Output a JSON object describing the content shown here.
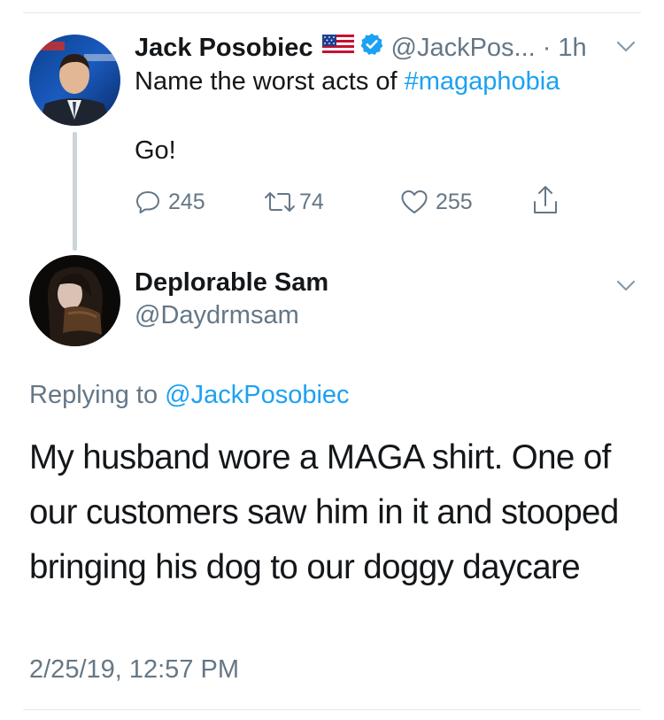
{
  "tweet1": {
    "name": "Jack Posobiec",
    "handle": "@JackPos...",
    "time": "· 1h",
    "text_prefix": "Name the worst acts of ",
    "hashtag": "#magaphobia",
    "text_line2": "Go!",
    "reply_count": "245",
    "retweet_count": "74",
    "like_count": "255",
    "icons": [
      "us-flag-icon",
      "verified-badge-icon",
      "chevron-down-icon",
      "reply-icon",
      "retweet-icon",
      "like-icon",
      "share-icon"
    ]
  },
  "tweet2": {
    "name": "Deplorable Sam",
    "handle": "@Daydrmsam",
    "replying_prefix": "Replying to ",
    "replying_handle": "@JackPosobiec",
    "body": "My husband wore a MAGA shirt. One of our customers saw him in it and stooped bringing his dog to our doggy daycare",
    "timestamp": "2/25/19, 12:57 PM",
    "icons": [
      "chevron-down-icon"
    ]
  },
  "colors": {
    "link": "#1da1f2",
    "muted": "#657786",
    "text": "#14171a",
    "verified": "#1da1f2",
    "divider": "#e1e8ed"
  }
}
